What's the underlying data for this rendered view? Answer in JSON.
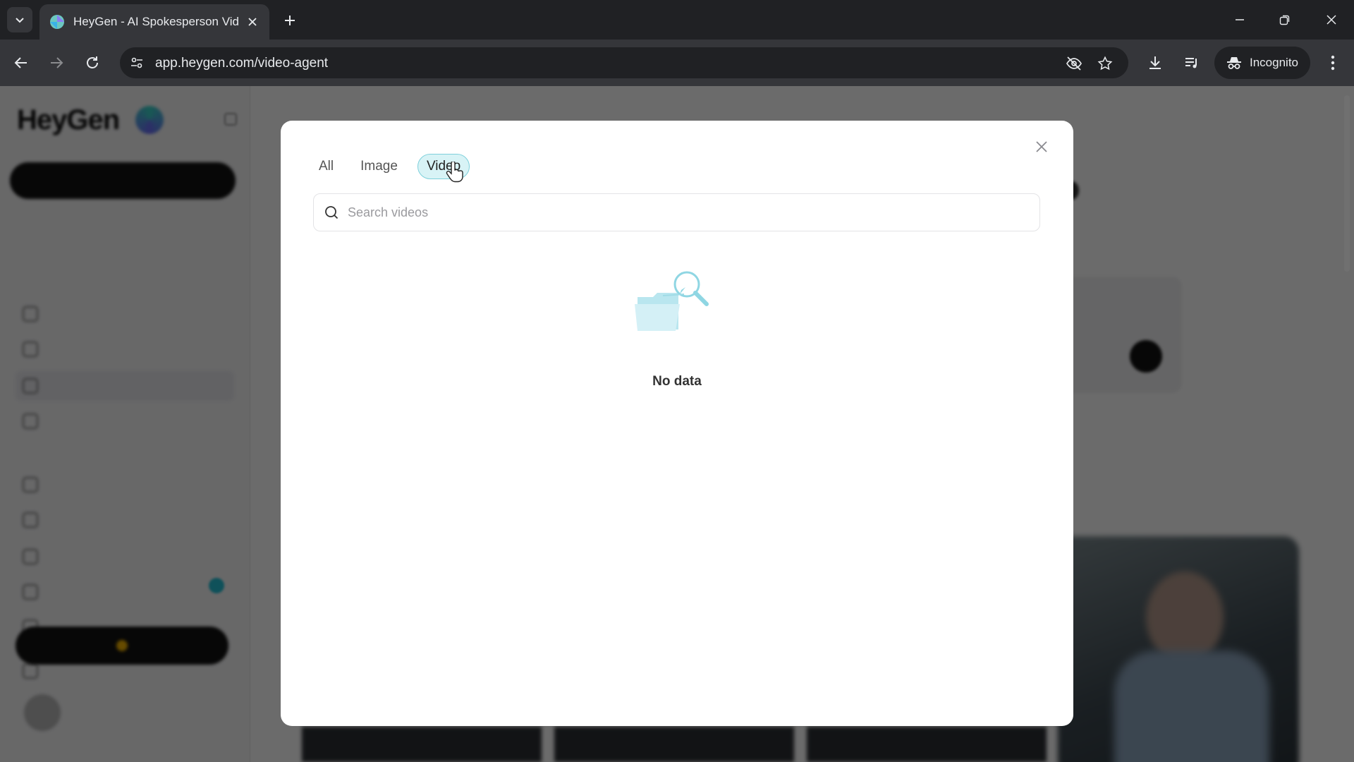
{
  "browser": {
    "tab_title": "HeyGen - AI Spokesperson Vide",
    "url": "app.heygen.com/video-agent",
    "incognito_label": "Incognito",
    "icons": [
      "chevron-down-icon",
      "heygen-favicon",
      "close-icon",
      "plus-icon",
      "minimize-icon",
      "restore-icon",
      "close-window-icon",
      "back-icon",
      "forward-icon",
      "reload-icon",
      "site-settings-icon",
      "eye-off-icon",
      "star-icon",
      "download-icon",
      "media-control-icon",
      "incognito-icon",
      "more-vert-icon"
    ]
  },
  "modal": {
    "tabs": [
      {
        "label": "All"
      },
      {
        "label": "Image"
      },
      {
        "label": "Video",
        "selected": true
      }
    ],
    "search": {
      "placeholder": "Search videos",
      "value": ""
    },
    "empty_text": "No data",
    "accent_color": "#7ed0db",
    "selected_tab_bg": "#d8f3f6"
  },
  "colors": {
    "chrome_bg": "#202124",
    "chrome_toolbar": "#35363a",
    "scrim": "rgba(0,0,0,0.58)"
  }
}
